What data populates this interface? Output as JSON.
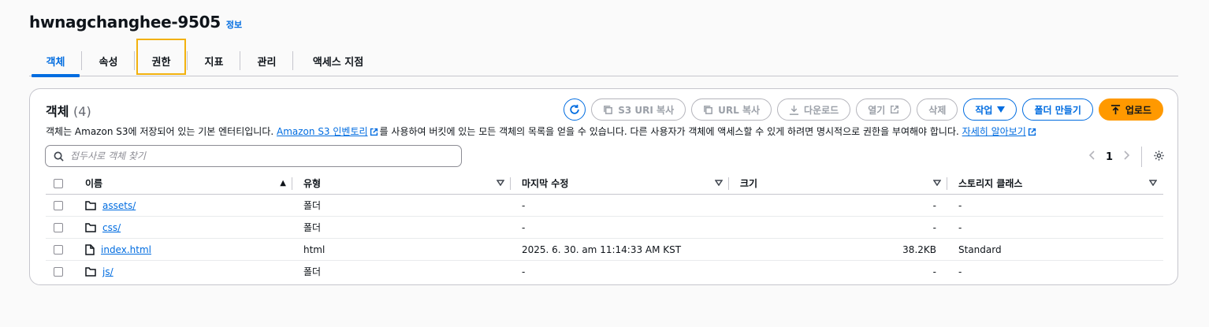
{
  "header": {
    "title": "hwnagchanghee-9505",
    "info": "정보"
  },
  "tabs": [
    {
      "label": "객체",
      "active": true
    },
    {
      "label": "속성"
    },
    {
      "label": "권한",
      "focused": true
    },
    {
      "label": "지표"
    },
    {
      "label": "관리"
    },
    {
      "label": "액세스 지점"
    }
  ],
  "panel": {
    "title": "객체",
    "count": "(4)",
    "actions": {
      "copy_s3_uri": "S3 URI 복사",
      "copy_url": "URL 복사",
      "download": "다운로드",
      "open": "열기",
      "delete": "삭제",
      "actions": "작업",
      "create_folder": "폴더 만들기",
      "upload": "업로드"
    },
    "description": {
      "part1": "객체는 Amazon S3에 저장되어 있는 기본 엔터티입니다. ",
      "link1": "Amazon S3 인벤토리",
      "part2": "를 사용하여 버킷에 있는 모든 객체의 목록을 얻을 수 있습니다. 다른 사용자가 객체에 액세스할 수 있게 하려면 명시적으로 권한을 부여해야 합니다. ",
      "link2": "자세히 알아보기"
    },
    "search": {
      "placeholder": "접두사로 객체 찾기",
      "value": ""
    },
    "pagination": {
      "page": "1"
    }
  },
  "table": {
    "headers": {
      "name": "이름",
      "type": "유형",
      "modified": "마지막 수정",
      "size": "크기",
      "storage_class": "스토리지 클래스"
    },
    "rows": [
      {
        "name": "assets/",
        "kind": "folder",
        "type": "폴더",
        "modified": "-",
        "size": "-",
        "storage_class": "-"
      },
      {
        "name": "css/",
        "kind": "folder",
        "type": "폴더",
        "modified": "-",
        "size": "-",
        "storage_class": "-"
      },
      {
        "name": "index.html",
        "kind": "file",
        "type": "html",
        "modified": "2025. 6. 30. am 11:14:33 AM KST",
        "size": "38.2KB",
        "storage_class": "Standard"
      },
      {
        "name": "js/",
        "kind": "folder",
        "type": "폴더",
        "modified": "-",
        "size": "-",
        "storage_class": "-"
      }
    ]
  },
  "colors": {
    "link": "#006ce0",
    "upload": "#ff9900",
    "focus": "#f2b10e"
  }
}
